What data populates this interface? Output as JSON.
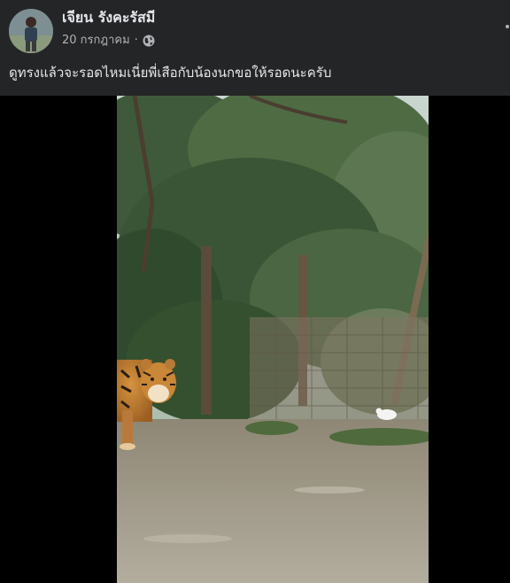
{
  "post": {
    "author": "เจียน รังคะรัสมี",
    "date": "20 กรกฎาคม",
    "separator": "·",
    "privacy_icon": "globe-icon",
    "more_icon": "more-options-icon",
    "caption": "ดูทรงแล้วจะรอดไหมเนี่ยพี่เสือกับน้องนกขอให้รอดนะครับ"
  },
  "media": {
    "type": "video",
    "subject": "tiger-and-white-bird-by-fence"
  },
  "colors": {
    "background": "#242526",
    "primary_text": "#e4e6eb",
    "secondary_text": "#b0b3b8",
    "video_letterbox": "#000000"
  }
}
